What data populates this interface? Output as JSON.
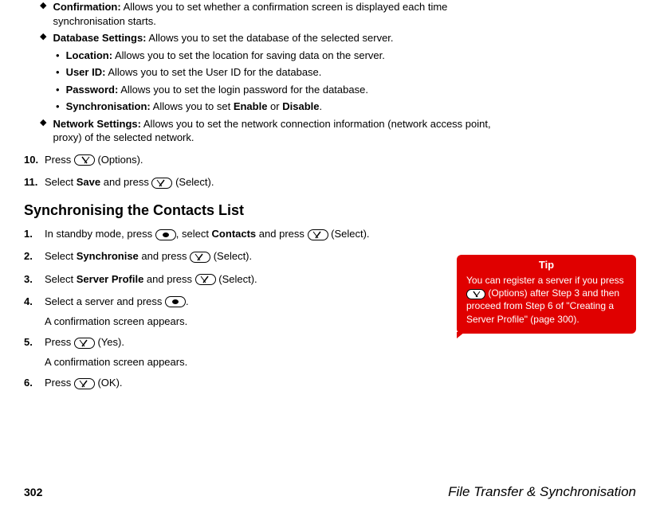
{
  "bullets": {
    "confirmation": {
      "label": "Confirmation:",
      "text": " Allows you to set whether a confirmation screen is displayed each time synchronisation starts."
    },
    "database": {
      "label": "Database Settings:",
      "text": " Allows you to set the database of the selected server."
    },
    "location": {
      "label": "Location:",
      "text": " Allows you to set the location for saving data on the server."
    },
    "userid": {
      "label": "User ID:",
      "text": " Allows you to set the User ID for the database."
    },
    "password": {
      "label": "Password:",
      "text": " Allows you to set the login password for the database."
    },
    "synchronisation": {
      "label": "Synchronisation:",
      "text_a": " Allows you to set ",
      "enable": "Enable",
      "or": " or ",
      "disable": "Disable",
      "period": "."
    },
    "network": {
      "label": "Network Settings:",
      "text": " Allows you to set the network connection information (network access point, proxy) of the selected network."
    }
  },
  "steps": {
    "s10": {
      "num": "10.",
      "text_a": "Press ",
      "text_b": " (Options)."
    },
    "s11": {
      "num": "11.",
      "text_a": "Select ",
      "save": "Save",
      "text_b": " and press ",
      "text_c": " (Select)."
    }
  },
  "heading": "Synchronising the Contacts List",
  "sync_steps": {
    "s1": {
      "num": "1.",
      "text_a": "In standby mode, press ",
      "text_b": ", select ",
      "contacts": "Contacts",
      "text_c": " and press ",
      "text_d": " (Select)."
    },
    "s2": {
      "num": "2.",
      "text_a": "Select ",
      "synchronise": "Synchronise",
      "text_b": " and press ",
      "text_c": " (Select)."
    },
    "s3": {
      "num": "3.",
      "text_a": "Select ",
      "server_profile": "Server Profile",
      "text_b": " and press ",
      "text_c": " (Select)."
    },
    "s4": {
      "num": "4.",
      "text_a": "Select a server and press ",
      "text_b": ".",
      "confirm": "A confirmation screen appears."
    },
    "s5": {
      "num": "5.",
      "text_a": "Press ",
      "text_b": " (Yes).",
      "confirm": "A confirmation screen appears."
    },
    "s6": {
      "num": "6.",
      "text_a": "Press ",
      "text_b": " (OK)."
    }
  },
  "tip": {
    "header": "Tip",
    "body_a": "You can register a server if you press ",
    "body_b": " (Options) after Step 3 and then proceed from Step 6 of \"Creating a Server Profile\" (page 300)."
  },
  "footer": {
    "page": "302",
    "title": "File Transfer & Synchronisation"
  }
}
